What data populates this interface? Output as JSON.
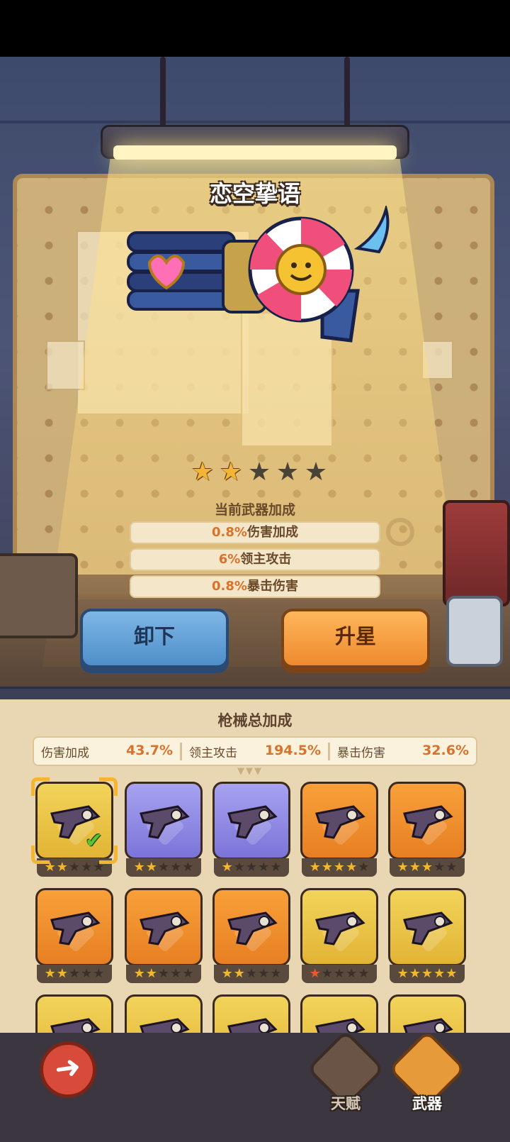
{
  "weapon": {
    "name": "恋空挚语",
    "stars": 2,
    "max_stars": 5,
    "bonus_title": "当前武器加成",
    "bonuses": [
      {
        "value": "0.8%",
        "label": "伤害加成"
      },
      {
        "value": "6%",
        "label": "领主攻击"
      },
      {
        "value": "0.8%",
        "label": "暴击伤害"
      }
    ]
  },
  "actions": {
    "unequip_label": "卸下",
    "upgrade_label": "升星"
  },
  "totals": {
    "title": "枪械总加成",
    "items": [
      {
        "label": "伤害加成",
        "value": "43.7%"
      },
      {
        "label": "领主攻击",
        "value": "194.5%"
      },
      {
        "label": "暴击伤害",
        "value": "32.6%"
      }
    ]
  },
  "inventory": [
    {
      "rarity": "gold",
      "stars": 2,
      "selected": true,
      "equipped": true,
      "color": "#f2d45a",
      "icon": "candy-gun-icon"
    },
    {
      "rarity": "purple",
      "stars": 2,
      "color": "#a7a3f0",
      "icon": "gun-icon"
    },
    {
      "rarity": "purple",
      "stars": 1,
      "color": "#a7a3f0",
      "icon": "gun-icon"
    },
    {
      "rarity": "orange",
      "stars": 4,
      "color": "#f8a03a",
      "icon": "gun-icon"
    },
    {
      "rarity": "orange",
      "stars": 3,
      "color": "#f8a03a",
      "icon": "gun-icon"
    },
    {
      "rarity": "orange",
      "stars": 2,
      "color": "#f8a03a",
      "icon": "gun-icon"
    },
    {
      "rarity": "orange",
      "stars": 2,
      "color": "#f8a03a",
      "icon": "gun-icon"
    },
    {
      "rarity": "orange",
      "stars": 2,
      "color": "#f8a03a",
      "icon": "gun-icon"
    },
    {
      "rarity": "gold",
      "stars": 0,
      "special": true,
      "color": "#f2d45a",
      "icon": "gun-icon"
    },
    {
      "rarity": "gold",
      "stars": 5,
      "color": "#f2d45a",
      "icon": "gun-icon"
    },
    {
      "rarity": "gold",
      "stars": 0,
      "color": "#f2d45a",
      "icon": "gun-icon"
    },
    {
      "rarity": "gold",
      "stars": 0,
      "color": "#f2d45a",
      "icon": "gun-icon"
    },
    {
      "rarity": "gold",
      "stars": 0,
      "color": "#f2d45a",
      "icon": "gun-icon"
    },
    {
      "rarity": "gold",
      "stars": 0,
      "color": "#f2d45a",
      "icon": "gun-icon"
    },
    {
      "rarity": "gold",
      "stars": 0,
      "color": "#f2d45a",
      "icon": "gun-icon"
    }
  ],
  "nav": {
    "talent_label": "天赋",
    "weapon_label": "武器",
    "back_icon": "back-arrow-icon"
  }
}
